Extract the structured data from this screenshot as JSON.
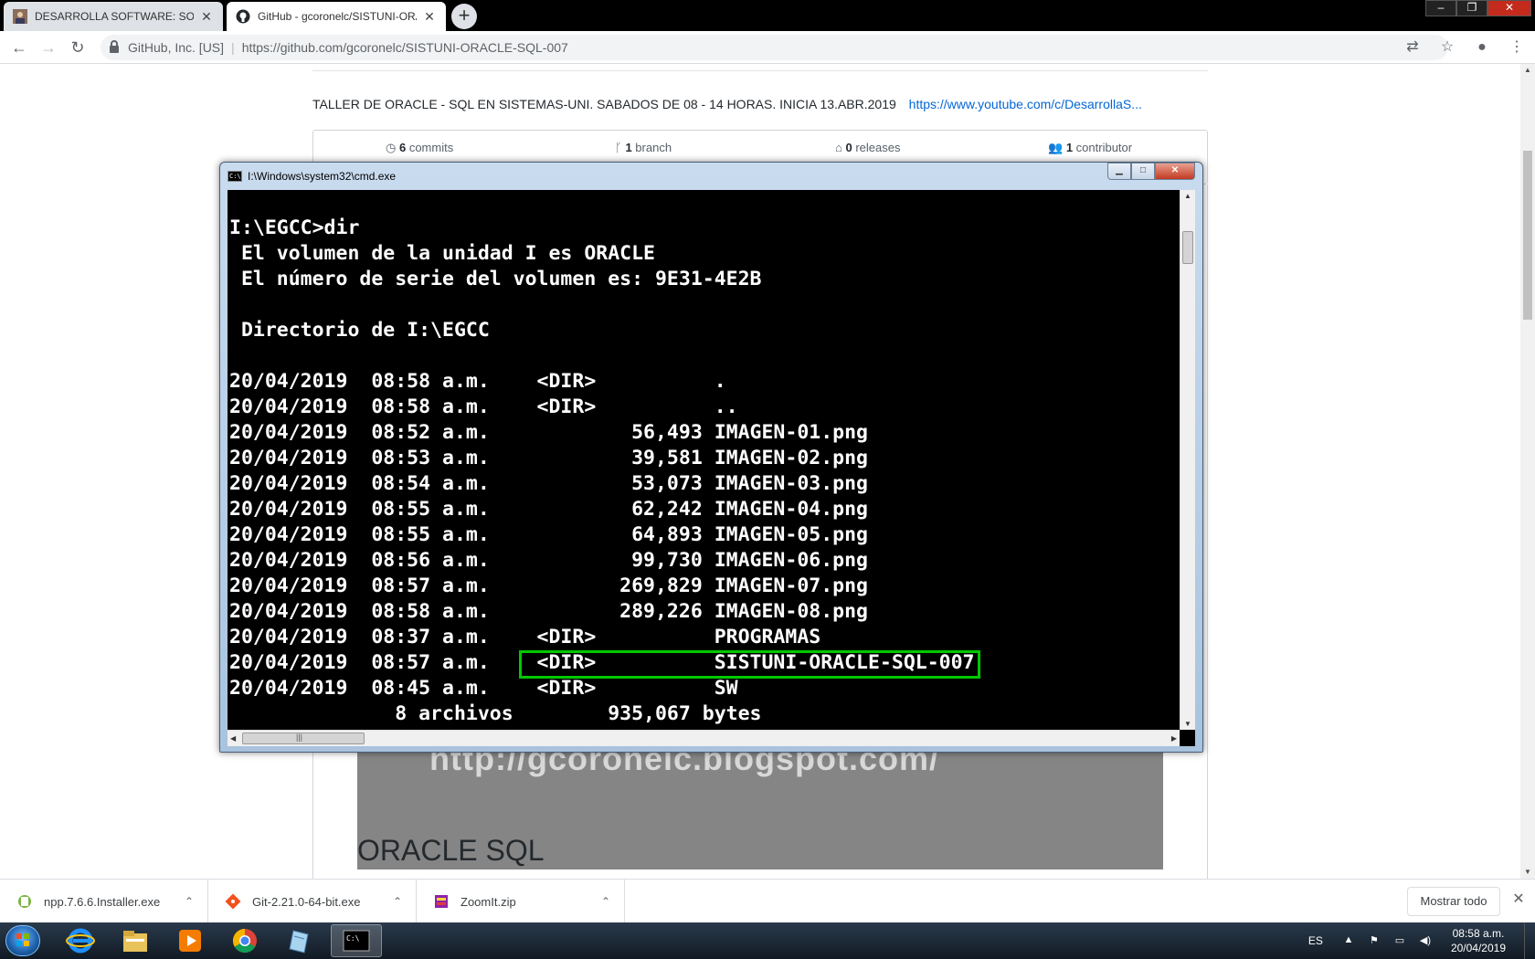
{
  "browser": {
    "tabs": [
      {
        "title": "DESARROLLA SOFTWARE: SOBRE",
        "active": false
      },
      {
        "title": "GitHub - gcoronelc/SISTUNI-ORA",
        "active": true
      }
    ],
    "new_tab": "+",
    "window_controls": {
      "minimize": "‒",
      "maximize": "❐",
      "close": "✕"
    },
    "omnibox": {
      "site": "GitHub, Inc. [US]",
      "url": "https://github.com/gcoronelc/SISTUNI-ORACLE-SQL-007"
    }
  },
  "repo": {
    "description": "TALLER DE ORACLE - SQL EN SISTEMAS-UNI. SABADOS DE 08 - 14 HORAS. INICIA 13.ABR.2019",
    "website": "https://www.youtube.com/c/DesarrollaS...",
    "stats": [
      {
        "count": "6",
        "label": "commits",
        "icon": "history-icon"
      },
      {
        "count": "1",
        "label": "branch",
        "icon": "branch-icon"
      },
      {
        "count": "0",
        "label": "releases",
        "icon": "tag-icon"
      },
      {
        "count": "1",
        "label": "contributor",
        "icon": "people-icon"
      }
    ],
    "banner_text": "http://gcoronelc.blogspot.com/",
    "readme_heading": "ORACLE SQL"
  },
  "cmd": {
    "title": "I:\\Windows\\system32\\cmd.exe",
    "lines": [
      "",
      "I:\\EGCC>dir",
      " El volumen de la unidad I es ORACLE",
      " El número de serie del volumen es: 9E31-4E2B",
      "",
      " Directorio de I:\\EGCC",
      "",
      "20/04/2019  08:58 a.m.    <DIR>          .",
      "20/04/2019  08:58 a.m.    <DIR>          ..",
      "20/04/2019  08:52 a.m.            56,493 IMAGEN-01.png",
      "20/04/2019  08:53 a.m.            39,581 IMAGEN-02.png",
      "20/04/2019  08:54 a.m.            53,073 IMAGEN-03.png",
      "20/04/2019  08:55 a.m.            62,242 IMAGEN-04.png",
      "20/04/2019  08:55 a.m.            64,893 IMAGEN-05.png",
      "20/04/2019  08:56 a.m.            99,730 IMAGEN-06.png",
      "20/04/2019  08:57 a.m.           269,829 IMAGEN-07.png",
      "20/04/2019  08:58 a.m.           289,226 IMAGEN-08.png",
      "20/04/2019  08:37 a.m.    <DIR>          PROGRAMAS",
      "20/04/2019  08:57 a.m.    <DIR>          SISTUNI-ORACLE-SQL-007",
      "20/04/2019  08:45 a.m.    <DIR>          SW",
      "              8 archivos        935,067 bytes"
    ],
    "hscroll_grip": "|||"
  },
  "downloads": {
    "items": [
      {
        "name": "npp.7.6.6.Installer.exe"
      },
      {
        "name": "Git-2.21.0-64-bit.exe"
      },
      {
        "name": "ZoomIt.zip"
      }
    ],
    "show_all": "Mostrar todo"
  },
  "taskbar": {
    "language": "ES",
    "time": "08:58 a.m.",
    "date": "20/04/2019",
    "apps": [
      "internet-explorer",
      "file-explorer",
      "media-player",
      "chrome",
      "notepad",
      "cmd"
    ]
  },
  "colors": {
    "cmd_bg": "#000000",
    "cmd_fg": "#ffffff",
    "highlight": "#00c800",
    "link": "#0366d6"
  }
}
